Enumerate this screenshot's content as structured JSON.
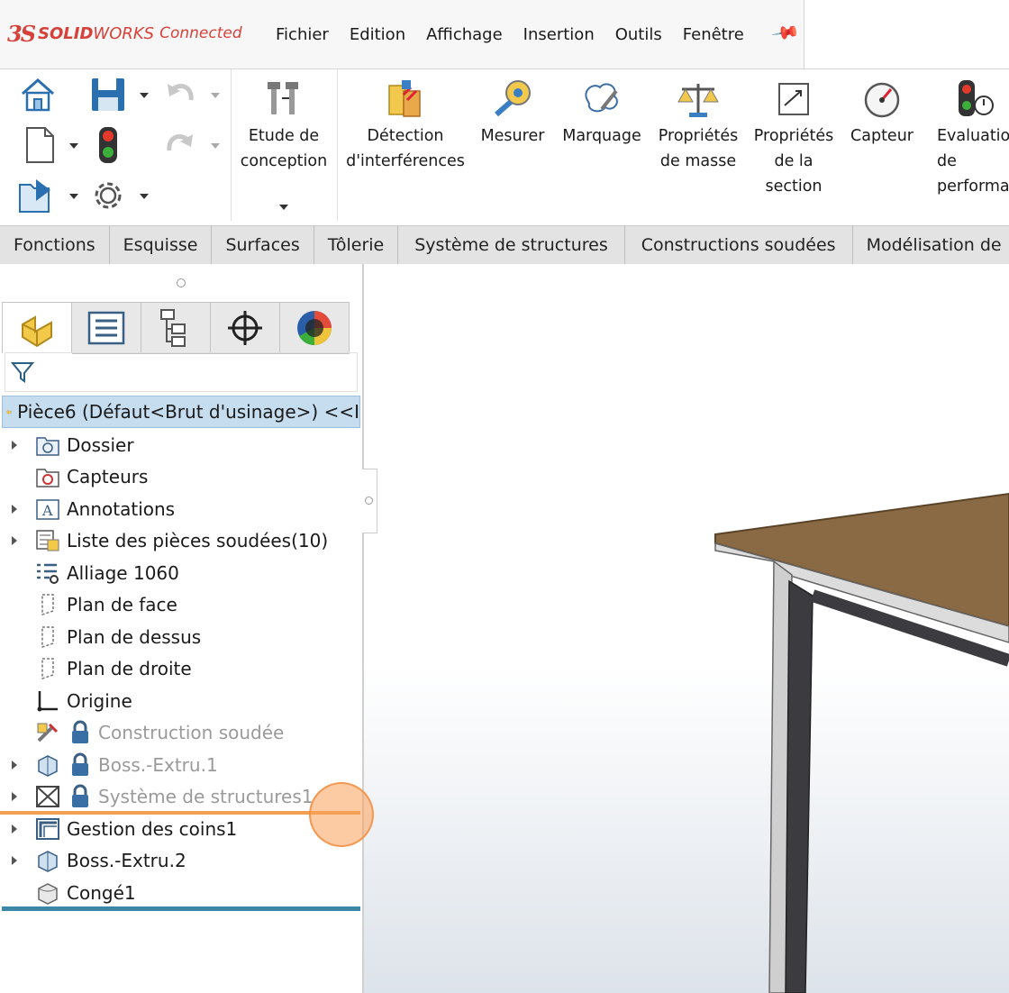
{
  "app": {
    "logo_ds": "3S",
    "logo_solid": "SOLID",
    "logo_works": "WORKS",
    "logo_connected": "Connected"
  },
  "menu": [
    "Fichier",
    "Edition",
    "Affichage",
    "Insertion",
    "Outils",
    "Fenêtre"
  ],
  "toolbar": {
    "etude": "Etude de\nconception",
    "tools": [
      {
        "label": "Détection\nd'interférences",
        "icon": "interference-icon"
      },
      {
        "label": "Mesurer",
        "icon": "measure-icon"
      },
      {
        "label": "Marquage",
        "icon": "markup-icon"
      },
      {
        "label": "Propriétés\nde masse",
        "icon": "mass-properties-icon"
      },
      {
        "label": "Propriétés\nde la\nsection",
        "icon": "section-properties-icon"
      },
      {
        "label": "Capteur",
        "icon": "sensor-icon"
      },
      {
        "label": "Evaluatio\nde\nperformar",
        "icon": "performance-icon"
      }
    ]
  },
  "tabs": [
    "Fonctions",
    "Esquisse",
    "Surfaces",
    "Tôlerie",
    "Système de structures",
    "Constructions soudées",
    "Modélisation de"
  ],
  "tree": {
    "root": "Pièce6 (Défaut<Brut d'usinage>) <<I",
    "items": [
      {
        "label": "Dossier",
        "icon": "folder-icon",
        "expand": true,
        "suppressed": false
      },
      {
        "label": "Capteurs",
        "icon": "sensors-icon",
        "expand": false,
        "suppressed": false
      },
      {
        "label": "Annotations",
        "icon": "annotations-icon",
        "expand": true,
        "suppressed": false
      },
      {
        "label": "Liste des pièces soudées(10)",
        "icon": "cutlist-icon",
        "expand": true,
        "suppressed": false
      },
      {
        "label": "Alliage 1060",
        "icon": "material-icon",
        "expand": false,
        "suppressed": false
      },
      {
        "label": "Plan de face",
        "icon": "plane-icon",
        "expand": false,
        "suppressed": false
      },
      {
        "label": "Plan de dessus",
        "icon": "plane-icon",
        "expand": false,
        "suppressed": false
      },
      {
        "label": "Plan de droite",
        "icon": "plane-icon",
        "expand": false,
        "suppressed": false
      },
      {
        "label": "Origine",
        "icon": "origin-icon",
        "expand": false,
        "suppressed": false
      },
      {
        "label": "Construction soudée",
        "icon": "weldment-icon",
        "expand": false,
        "suppressed": true
      },
      {
        "label": "Boss.-Extru.1",
        "icon": "extrude-icon",
        "expand": true,
        "suppressed": true
      },
      {
        "label": "Système de structures1",
        "icon": "structure-system-icon",
        "expand": true,
        "suppressed": true
      },
      {
        "label": "Gestion des coins1",
        "icon": "corner-management-icon",
        "expand": true,
        "suppressed": false
      },
      {
        "label": "Boss.-Extru.2",
        "icon": "extrude-icon",
        "expand": true,
        "suppressed": false
      },
      {
        "label": "Congé1",
        "icon": "fillet-icon",
        "expand": false,
        "suppressed": false
      }
    ]
  }
}
